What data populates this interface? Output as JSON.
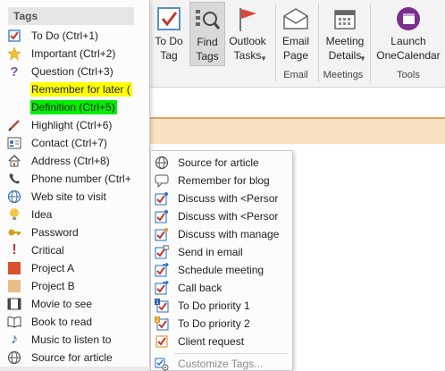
{
  "ribbon": {
    "todo_tag": "To Do\nTag",
    "find_tags": "Find\nTags",
    "outlook_tasks": "Outlook\nTasks",
    "email_page": "Email\nPage",
    "meeting_details": "Meeting\nDetails",
    "launch_onecalendar": "Launch\nOneCalendar",
    "groups": {
      "email": "Email",
      "meetings": "Meetings",
      "tools": "Tools"
    }
  },
  "tags_menu": {
    "header": "Tags",
    "items": [
      {
        "label": "To Do (Ctrl+1)",
        "icon": "checkbox-checked-icon"
      },
      {
        "label": "Important (Ctrl+2)",
        "icon": "star-icon"
      },
      {
        "label": "Question (Ctrl+3)",
        "icon": "question-mark-icon"
      },
      {
        "label": "Remember for later (",
        "icon": "none",
        "highlight": "#ffff00"
      },
      {
        "label": "Definition (Ctrl+5)",
        "icon": "none",
        "highlight": "#00ee00"
      },
      {
        "label": "Highlight (Ctrl+6)",
        "icon": "highlighter-pen-icon"
      },
      {
        "label": "Contact (Ctrl+7)",
        "icon": "contact-card-icon"
      },
      {
        "label": "Address (Ctrl+8)",
        "icon": "house-icon"
      },
      {
        "label": "Phone number (Ctrl+",
        "icon": "phone-icon"
      },
      {
        "label": "Web site to visit",
        "icon": "globe-icon"
      },
      {
        "label": "Idea",
        "icon": "lightbulb-icon"
      },
      {
        "label": "Password",
        "icon": "key-icon"
      },
      {
        "label": "Critical",
        "icon": "exclamation-icon"
      },
      {
        "label": "Project A",
        "icon": "red-square-icon"
      },
      {
        "label": "Project B",
        "icon": "tan-square-icon"
      },
      {
        "label": "Movie to see",
        "icon": "film-strip-icon"
      },
      {
        "label": "Book to read",
        "icon": "book-icon"
      },
      {
        "label": "Music to listen to",
        "icon": "music-note-icon"
      },
      {
        "label": "Source for article",
        "icon": "globe-link-icon"
      }
    ]
  },
  "sub_menu": {
    "items": [
      {
        "label": "Source for article",
        "icon": "globe-link-icon"
      },
      {
        "label": "Remember for blog",
        "icon": "speech-bubble-icon"
      },
      {
        "label": "Discuss with <Persor",
        "icon": "checkbox-person-icon"
      },
      {
        "label": "Discuss with <Persor",
        "icon": "checkbox-person-icon"
      },
      {
        "label": "Discuss with manage",
        "icon": "checkbox-person-icon"
      },
      {
        "label": "Send in email",
        "icon": "checkbox-envelope-icon"
      },
      {
        "label": "Schedule meeting",
        "icon": "checkbox-arrow-icon"
      },
      {
        "label": "Call back",
        "icon": "checkbox-arrow-icon"
      },
      {
        "label": "To Do priority 1",
        "icon": "checkbox-priority1-icon"
      },
      {
        "label": "To Do priority 2",
        "icon": "checkbox-priority2-icon"
      },
      {
        "label": "Client request",
        "icon": "checkbox-checked-icon"
      }
    ],
    "customize_label": "Customize Tags..."
  },
  "colors": {
    "accent_blue": "#1f6fbf",
    "check_red": "#c0392b",
    "band_orange": "#f8e0c0",
    "project_a": "#d9542b",
    "project_b": "#e7be86",
    "onenote_purple": "#7a2e8e"
  }
}
